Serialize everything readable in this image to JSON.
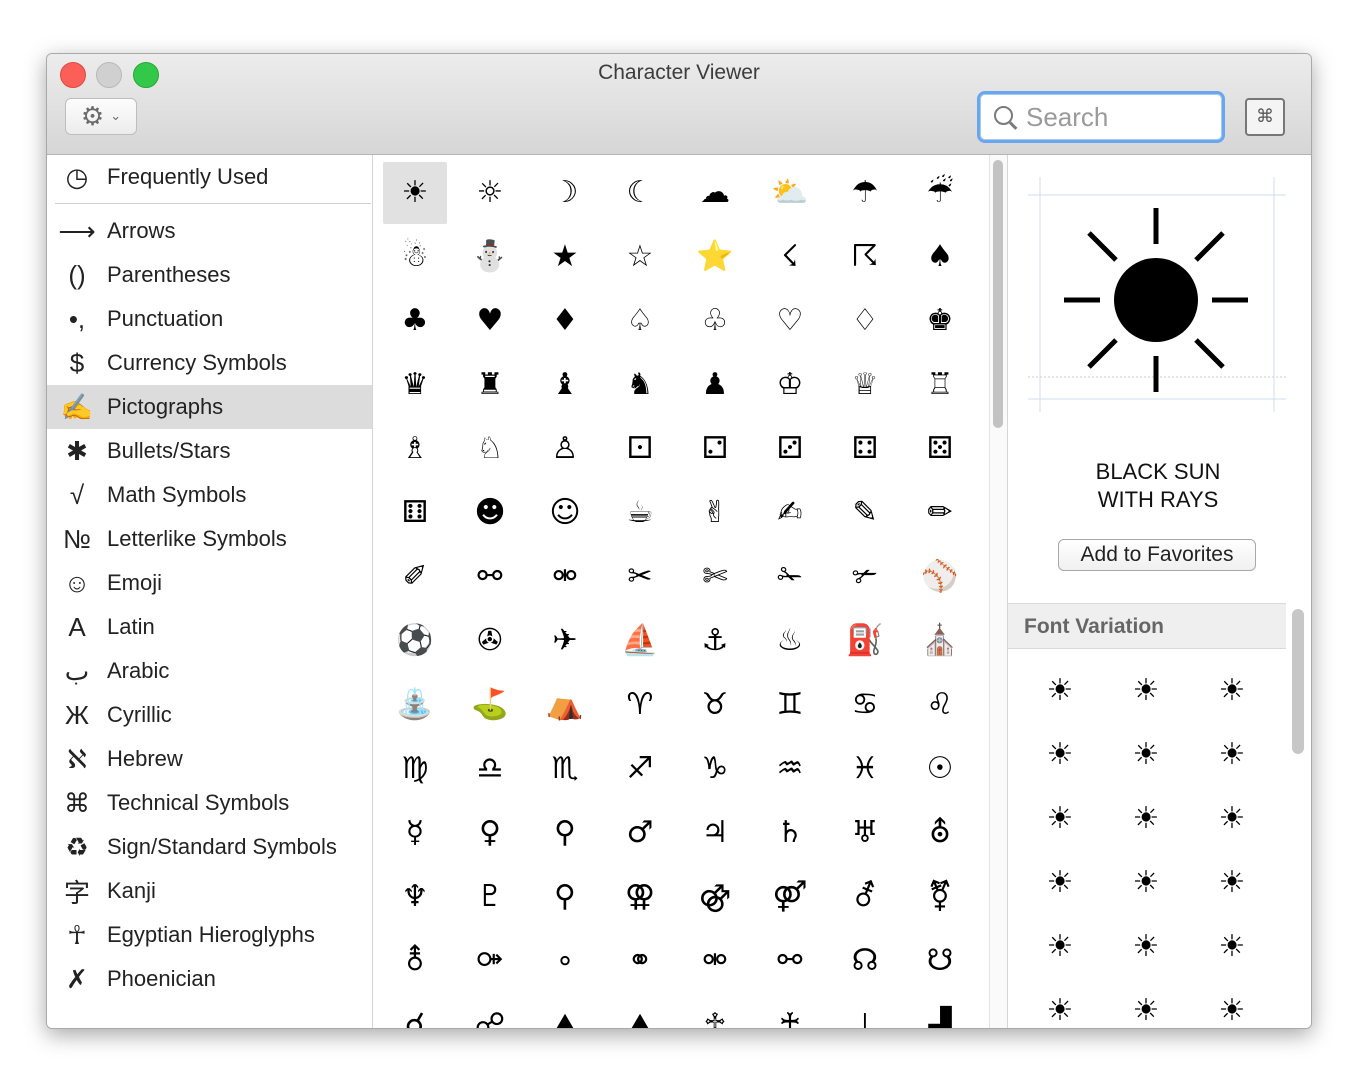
{
  "window": {
    "title": "Character Viewer"
  },
  "toolbar": {
    "gear_icon": "gear-icon",
    "search_placeholder": "Search",
    "keyboard_icon": "keyboard-icon"
  },
  "sidebar": {
    "items": [
      {
        "icon": "◷",
        "label": "Frequently Used"
      },
      {
        "icon": "⟶",
        "label": "Arrows"
      },
      {
        "icon": "()",
        "label": "Parentheses"
      },
      {
        "icon": "•,",
        "label": "Punctuation"
      },
      {
        "icon": "$",
        "label": "Currency Symbols"
      },
      {
        "icon": "✍",
        "label": "Pictographs",
        "selected": true
      },
      {
        "icon": "✱",
        "label": "Bullets/Stars"
      },
      {
        "icon": "√",
        "label": "Math Symbols"
      },
      {
        "icon": "№",
        "label": "Letterlike Symbols"
      },
      {
        "icon": "☺",
        "label": "Emoji"
      },
      {
        "icon": "A",
        "label": "Latin"
      },
      {
        "icon": "ب",
        "label": "Arabic"
      },
      {
        "icon": "Ж",
        "label": "Cyrillic"
      },
      {
        "icon": "ℵ",
        "label": "Hebrew"
      },
      {
        "icon": "⌘",
        "label": "Technical Symbols"
      },
      {
        "icon": "♻",
        "label": "Sign/Standard Symbols"
      },
      {
        "icon": "字",
        "label": "Kanji"
      },
      {
        "icon": "☥",
        "label": "Egyptian Hieroglyphs"
      },
      {
        "icon": "✗",
        "label": "Phoenician"
      }
    ]
  },
  "grid": {
    "rows": [
      [
        "☀",
        "☼",
        "☽",
        "☾",
        "☁",
        "⛅",
        "☂",
        "☔"
      ],
      [
        "☃",
        "⛄",
        "★",
        "☆",
        "⭐",
        "☇",
        "☈",
        "♠"
      ],
      [
        "♣",
        "♥",
        "♦",
        "♤",
        "♧",
        "♡",
        "♢",
        "♚"
      ],
      [
        "♛",
        "♜",
        "♝",
        "♞",
        "♟",
        "♔",
        "♕",
        "♖"
      ],
      [
        "♗",
        "♘",
        "♙",
        "⚀",
        "⚁",
        "⚂",
        "⚃",
        "⚄"
      ],
      [
        "⚅",
        "☻",
        "☺",
        "☕",
        "✌",
        "✍",
        "✎",
        "✏"
      ],
      [
        "✐",
        "⚯",
        "⚮",
        "✂",
        "✄",
        "✁",
        "✃",
        "⚾"
      ],
      [
        "⚽",
        "✇",
        "✈",
        "⛵",
        "⚓",
        "♨",
        "⛽",
        "⛪"
      ],
      [
        "⛲",
        "⛳",
        "⛺",
        "♈",
        "♉",
        "♊",
        "♋",
        "♌"
      ],
      [
        "♍",
        "♎",
        "♏",
        "♐",
        "♑",
        "♒",
        "♓",
        "☉"
      ],
      [
        "☿",
        "♀",
        "⚲",
        "♂",
        "♃",
        "♄",
        "♅",
        "⛢"
      ],
      [
        "♆",
        "♇",
        "⚲",
        "⚢",
        "⚣",
        "⚤",
        "⚦",
        "⚧"
      ],
      [
        "⚨",
        "⚩",
        "∘",
        "⚭",
        "⚮",
        "⚯",
        "☊",
        "☋"
      ],
      [
        "☌",
        "☍",
        "⛰",
        "⛰",
        "♱",
        "♰",
        "⊥",
        "▟"
      ]
    ]
  },
  "detail": {
    "selected_char": "☀",
    "name_line1": "BLACK SUN",
    "name_line2": "WITH RAYS",
    "add_favorites": "Add to Favorites",
    "font_variation_title": "Font Variation",
    "variations": [
      "☀",
      "☀",
      "☀",
      "☀",
      "☀",
      "☀",
      "☀",
      "☀",
      "☀",
      "☀",
      "☀",
      "☀",
      "☀",
      "☀",
      "☀",
      "☀",
      "☀",
      "☀"
    ]
  }
}
